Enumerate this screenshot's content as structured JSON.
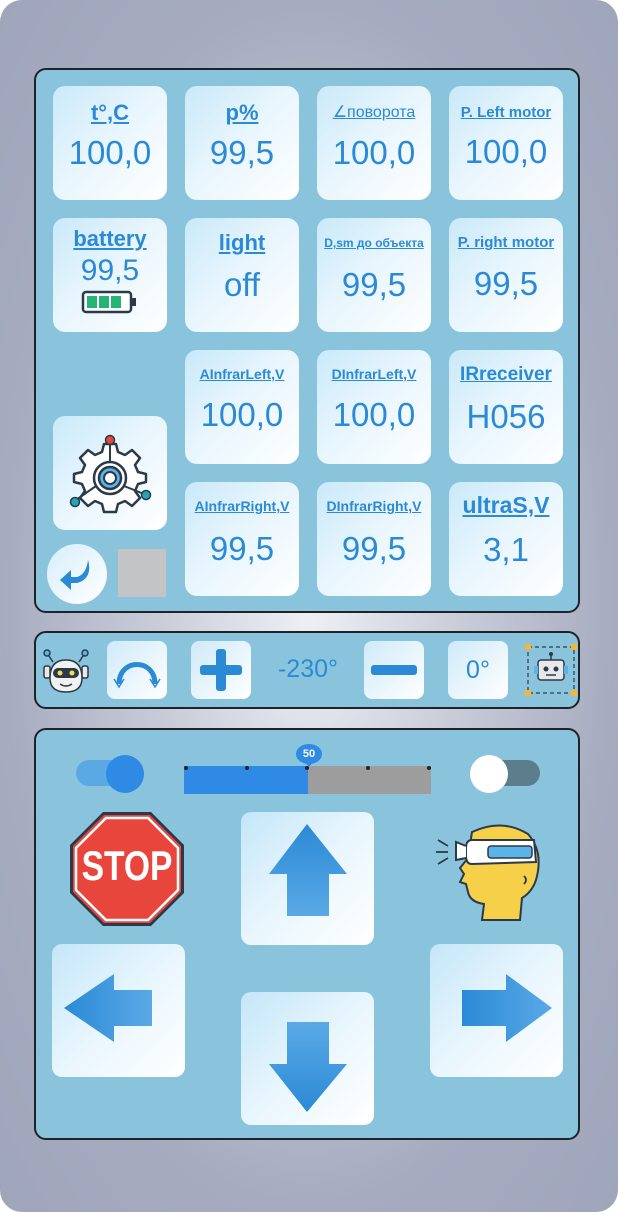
{
  "sensors": {
    "temp": {
      "label": "t°,C",
      "value": "100,0"
    },
    "pressure": {
      "label": "p%",
      "value": "99,5"
    },
    "rotation": {
      "label": "∠поворота",
      "value": "100,0"
    },
    "left_motor": {
      "label": "P. Left motor",
      "value": "100,0"
    },
    "battery": {
      "label": "battery",
      "value": "99,5",
      "level": 0.75
    },
    "light": {
      "label": "light",
      "value": "off"
    },
    "distance": {
      "label": "D,sm до объекта",
      "value": "99,5"
    },
    "right_motor": {
      "label": "P. right motor",
      "value": "99,5"
    },
    "a_infrar_left": {
      "label": "AInfrarLeft,V",
      "value": "100,0"
    },
    "d_infrar_left": {
      "label": "DInfrarLeft,V",
      "value": "100,0"
    },
    "ir_receiver": {
      "label": "IRreceiver",
      "value": "H056"
    },
    "a_infrar_right": {
      "label": "AInfrarRight,V",
      "value": "99,5"
    },
    "d_infrar_right": {
      "label": "DInfrarRight,V",
      "value": "99,5"
    },
    "ultrasonic": {
      "label": "ultraS,V",
      "value": "3,1"
    }
  },
  "rotation_bar": {
    "angle_value": "-230°",
    "servo_value": "0°",
    "icons": [
      "robot-head-icon",
      "arc-rotate-icon",
      "plus-icon",
      "minus-icon",
      "robot-frame-icon"
    ]
  },
  "drive": {
    "left_toggle_on": true,
    "right_toggle_on": false,
    "slider": {
      "value": "50",
      "fraction": 0.5
    },
    "stop_label": "STOP"
  },
  "colors": {
    "accent": "#2b8ad6",
    "panel": "#8ac4dc",
    "stop_red": "#e8453c"
  }
}
